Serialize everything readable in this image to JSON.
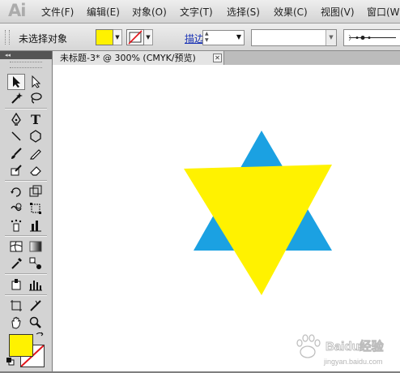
{
  "app": {
    "logo": "Ai"
  },
  "menu": [
    "文件(F)",
    "编辑(E)",
    "对象(O)",
    "文字(T)",
    "选择(S)",
    "效果(C)",
    "视图(V)",
    "窗口(W)"
  ],
  "control_bar": {
    "selection_label": "未选择对象",
    "fill_color": "#fff200",
    "stroke_label": "描边:"
  },
  "document": {
    "tab_title": "未标题-3* @ 300% (CMYK/预览)",
    "close_glyph": "✕"
  },
  "toolbox": {
    "collapse_glyph": "◂◂",
    "fill_color": "#fff200",
    "tools": [
      "selection-tool",
      "direct-selection-tool",
      "magic-wand-tool",
      "lasso-tool",
      "pen-tool",
      "type-tool",
      "line-tool",
      "ellipse-tool",
      "paintbrush-tool",
      "pencil-tool",
      "blob-brush-tool",
      "eraser-tool",
      "rotate-tool",
      "scale-tool",
      "warp-tool",
      "free-transform-tool",
      "symbol-sprayer-tool",
      "column-graph-tool",
      "mesh-tool",
      "gradient-tool",
      "eyedropper-tool",
      "blend-tool",
      "slice-tool",
      "bar-graph-tool",
      "artboard-tool",
      "knife-tool",
      "hand-tool",
      "zoom-tool"
    ]
  },
  "artwork": {
    "back_triangle_color": "#1ba1e2",
    "front_triangle_color": "#fff200"
  },
  "watermark": {
    "line1": "Baidu经验",
    "line2": "jingyan.baidu.com"
  }
}
